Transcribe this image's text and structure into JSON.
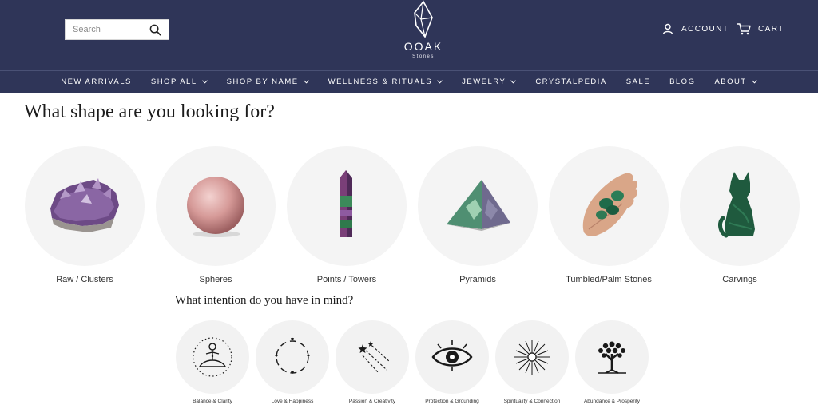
{
  "header": {
    "search": {
      "placeholder": "Search",
      "value": ""
    },
    "logo": {
      "brand": "OOAK",
      "sub": "Stones"
    },
    "account_label": "ACCOUNT",
    "cart_label": "CART",
    "colors": {
      "header_bg": "#2f3558",
      "text": "#ffffff"
    }
  },
  "nav": {
    "items": [
      {
        "label": "NEW ARRIVALS",
        "has_dropdown": false
      },
      {
        "label": "SHOP ALL",
        "has_dropdown": true
      },
      {
        "label": "SHOP BY NAME",
        "has_dropdown": true
      },
      {
        "label": "WELLNESS & RITUALS",
        "has_dropdown": true
      },
      {
        "label": "JEWELRY",
        "has_dropdown": true
      },
      {
        "label": "CRYSTALPEDIA",
        "has_dropdown": false
      },
      {
        "label": "SALE",
        "has_dropdown": false
      },
      {
        "label": "BLOG",
        "has_dropdown": false
      },
      {
        "label": "ABOUT",
        "has_dropdown": true
      }
    ]
  },
  "main": {
    "shape_title": "What shape are you looking for?",
    "shapes": [
      {
        "label": "Raw / Clusters",
        "icon": "amethyst-cluster-image"
      },
      {
        "label": "Spheres",
        "icon": "rose-quartz-sphere-image"
      },
      {
        "label": "Points / Towers",
        "icon": "fluorite-tower-image"
      },
      {
        "label": "Pyramids",
        "icon": "fluorite-pyramid-image"
      },
      {
        "label": "Tumbled/Palm Stones",
        "icon": "hand-with-stones-image"
      },
      {
        "label": "Carvings",
        "icon": "malachite-cat-carving-image"
      }
    ],
    "intention_title": "What intention do you have in mind?",
    "intentions": [
      {
        "label": "Balance & Clarity",
        "icon": "meditation-icon"
      },
      {
        "label": "Love & Happiness",
        "icon": "heart-circle-icon"
      },
      {
        "label": "Passion & Creativity",
        "icon": "shooting-stars-icon"
      },
      {
        "label": "Protection & Grounding",
        "icon": "evil-eye-icon"
      },
      {
        "label": "Spirituality & Connection",
        "icon": "starburst-icon"
      },
      {
        "label": "Abundance & Prosperity",
        "icon": "tree-icon"
      }
    ]
  }
}
